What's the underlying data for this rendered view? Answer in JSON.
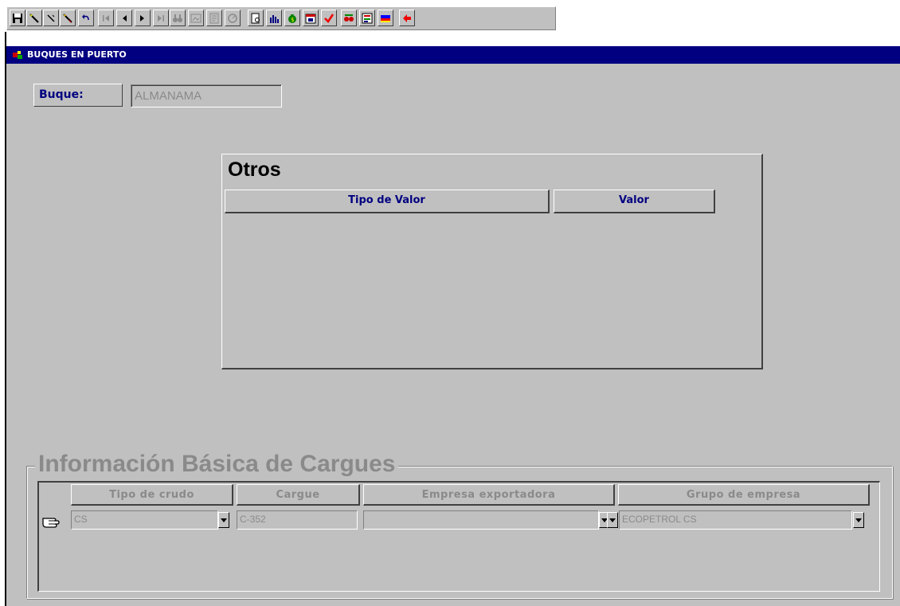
{
  "toolbar": {
    "buttons": [
      {
        "icon": "save-icon"
      },
      {
        "icon": "pencil-icon"
      },
      {
        "icon": "pen-icon"
      },
      {
        "icon": "eraser-icon"
      },
      {
        "icon": "undo-icon"
      },
      {
        "icon": "first-record-icon"
      },
      {
        "icon": "prev-record-icon"
      },
      {
        "icon": "next-record-icon"
      },
      {
        "icon": "last-record-icon"
      },
      {
        "icon": "binoculars-icon"
      },
      {
        "icon": "image-icon"
      },
      {
        "icon": "report-icon"
      },
      {
        "icon": "disabled-circle-icon"
      },
      {
        "icon": "print-preview-icon"
      },
      {
        "icon": "bar-chart-icon"
      },
      {
        "icon": "money-bag-icon"
      },
      {
        "icon": "calendar-icon"
      },
      {
        "icon": "checkmark-icon"
      },
      {
        "icon": "glasses-icon"
      },
      {
        "icon": "form-icon"
      },
      {
        "icon": "flag-icon"
      },
      {
        "icon": "exit-arrow-icon"
      }
    ]
  },
  "window": {
    "title": "BUQUES EN PUERTO"
  },
  "buque": {
    "label": "Buque:",
    "value": "ALMANAMA"
  },
  "otros": {
    "title": "Otros",
    "columns": [
      "Tipo de Valor",
      "Valor"
    ]
  },
  "info": {
    "title": "Información Básica de Cargues",
    "columns": [
      "Tipo de crudo",
      "Cargue",
      "Empresa exportadora",
      "Grupo de empresa"
    ],
    "row": {
      "tipo_crudo": "CS",
      "cargue": "C-352",
      "empresa_exportadora": "",
      "grupo_empresa": "ECOPETROL CS"
    }
  },
  "colors": {
    "title_bar": "#000080",
    "form_bg": "#c0c0c0",
    "label_text": "#000080",
    "disabled_text": "#8a8a8a"
  }
}
